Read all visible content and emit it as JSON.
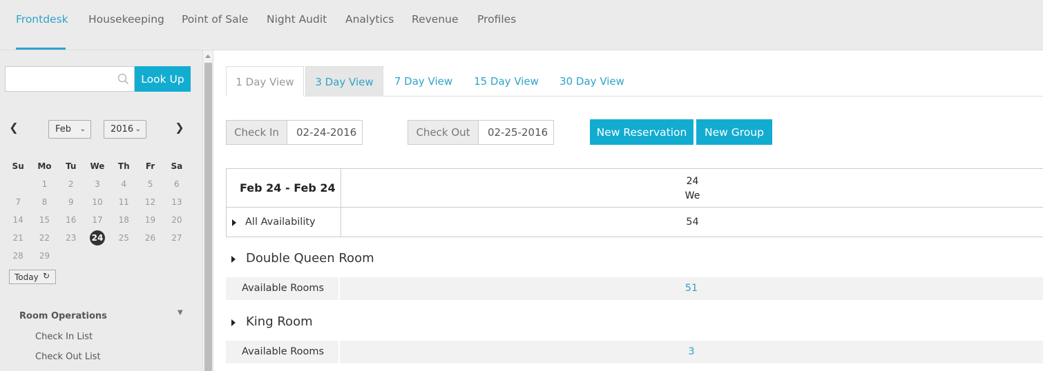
{
  "nav": {
    "items": [
      {
        "label": "Frontdesk"
      },
      {
        "label": "Housekeeping"
      },
      {
        "label": "Point of Sale"
      },
      {
        "label": "Night Audit"
      },
      {
        "label": "Analytics"
      },
      {
        "label": "Revenue"
      },
      {
        "label": "Profiles"
      }
    ],
    "active": "Frontdesk"
  },
  "sidebar": {
    "search": {
      "value": "",
      "placeholder": ""
    },
    "lookup_label": "Look Up",
    "calendar": {
      "month": "Feb",
      "year": "2016",
      "weekdays": [
        "Su",
        "Mo",
        "Tu",
        "We",
        "Th",
        "Fr",
        "Sa"
      ],
      "weeks": [
        [
          "",
          "1",
          "2",
          "3",
          "4",
          "5",
          "6"
        ],
        [
          "7",
          "8",
          "9",
          "10",
          "11",
          "12",
          "13"
        ],
        [
          "14",
          "15",
          "16",
          "17",
          "18",
          "19",
          "20"
        ],
        [
          "21",
          "22",
          "23",
          "24",
          "25",
          "26",
          "27"
        ],
        [
          "28",
          "29",
          "",
          "",
          "",
          "",
          ""
        ]
      ],
      "selected_day": "24",
      "today_label": "Today"
    },
    "room_operations": {
      "title": "Room Operations",
      "items": [
        "Check In List",
        "Check Out List"
      ]
    }
  },
  "main": {
    "tabs": [
      {
        "label": "1 Day View"
      },
      {
        "label": "3 Day View"
      },
      {
        "label": "7 Day View"
      },
      {
        "label": "15 Day View"
      },
      {
        "label": "30 Day View"
      }
    ],
    "active_tab": "1 Day View",
    "check_in": {
      "label": "Check In",
      "value": "02-24-2016"
    },
    "check_out": {
      "label": "Check Out",
      "value": "02-25-2016"
    },
    "buttons": {
      "new_reservation": "New Reservation",
      "new_group": "New Group"
    },
    "grid": {
      "range": "Feb 24 - Feb 24",
      "date_day": "24",
      "date_weekday": "We",
      "all_availability": {
        "label": "All Availability",
        "value": "54"
      },
      "room_types": [
        {
          "name": "Double Queen Room",
          "row_label": "Available Rooms",
          "value": "51"
        },
        {
          "name": "King Room",
          "row_label": "Available Rooms",
          "value": "3"
        }
      ]
    }
  },
  "colors": {
    "accent": "#13acd1",
    "link": "#2ea3c8",
    "nav_bg": "#ebebeb"
  }
}
